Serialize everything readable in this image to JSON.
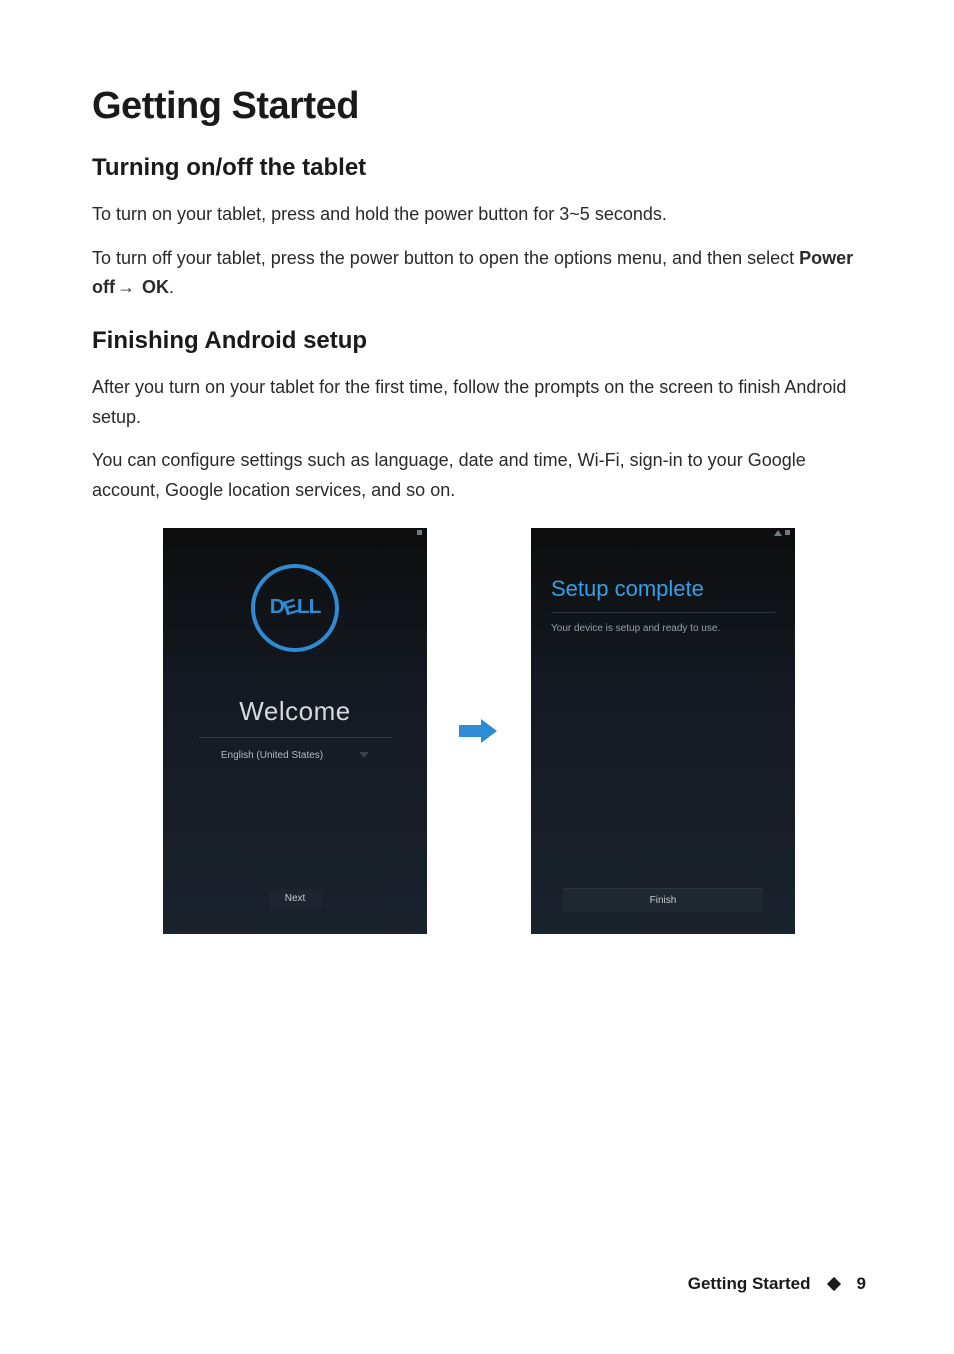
{
  "headings": {
    "h1": "Getting Started",
    "h2_turning": "Turning on/off the tablet",
    "h2_finishing": "Finishing Android setup"
  },
  "paragraphs": {
    "turn_on": "To turn on your tablet, press and hold the power button for 3~5 seconds.",
    "turn_off_pre": "To turn off your tablet, press the power button to open the options menu, and then select ",
    "power_off_bold": "Power off",
    "arrow": "→",
    "ok_bold": " OK",
    "period": ".",
    "finish_p1": "After you turn on your tablet for the first time, follow the prompts on the screen to finish Android setup.",
    "finish_p2": "You can configure settings such as language, date and time, Wi-Fi, sign-in to your Google account, Google location services, and so on."
  },
  "screens": {
    "welcome": {
      "logo_text": "DELL",
      "title": "Welcome",
      "language": "English (United States)",
      "button": "Next"
    },
    "setup_complete": {
      "title": "Setup complete",
      "body": "Your device is setup and ready to use.",
      "button": "Finish"
    }
  },
  "footer": {
    "section": "Getting Started",
    "page": "9"
  }
}
